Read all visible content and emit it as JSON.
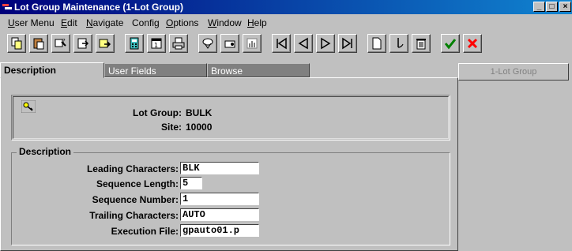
{
  "window": {
    "title": "Lot Group Maintenance (1-Lot Group)",
    "controls": {
      "minimize": "_",
      "maximize": "□",
      "close": "×"
    }
  },
  "menu": [
    {
      "mnemonic": "U",
      "rest": "ser Menu"
    },
    {
      "mnemonic": "E",
      "rest": "dit"
    },
    {
      "mnemonic": "N",
      "rest": "avigate"
    },
    {
      "mnemonic": "",
      "rest": "Config"
    },
    {
      "mnemonic": "O",
      "rest": "ptions"
    },
    {
      "mnemonic": "W",
      "rest": "indow"
    },
    {
      "mnemonic": "H",
      "rest": "elp"
    }
  ],
  "tabs": {
    "description": "Description",
    "user_fields": "User Fields",
    "browse": "Browse"
  },
  "side_button": "1-Lot Group",
  "header": {
    "lot_group_label": "Lot Group:",
    "lot_group_value": "BULK",
    "site_label": "Site:",
    "site_value": "10000"
  },
  "description_group": {
    "legend": "Description",
    "fields": {
      "leading_label": "Leading Characters:",
      "leading_value": "BLK",
      "seq_length_label": "Sequence Length:",
      "seq_length_value": "5",
      "seq_number_label": "Sequence Number:",
      "seq_number_value": "1",
      "trailing_label": "Trailing Characters:",
      "trailing_value": "AUTO",
      "exec_label": "Execution File:",
      "exec_value": "gpauto01.p"
    }
  },
  "toolbar_icons": [
    "copy-icon",
    "paste-icon",
    "find-icon",
    "browse-icon",
    "lookup-icon",
    "calculator-icon",
    "calendar-icon",
    "print-icon",
    "filter-icon",
    "export-icon",
    "report-icon",
    "first-record-icon",
    "previous-record-icon",
    "next-record-icon",
    "last-record-icon",
    "new-record-icon",
    "undo-icon",
    "delete-icon",
    "save-checkmark-icon",
    "cancel-x-icon"
  ],
  "colors": {
    "titlebar": "#00007b",
    "save": "#008000",
    "cancel": "#ff0000",
    "face": "#c0c0c0"
  }
}
